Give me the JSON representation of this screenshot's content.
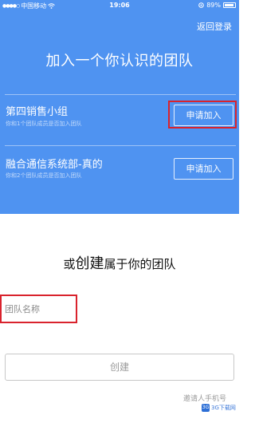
{
  "status_bar": {
    "carrier": "中国移动",
    "time": "19:06",
    "battery": "89%"
  },
  "header": {
    "back_login": "返回登录",
    "join_title": "加入一个你认识的团队"
  },
  "teams": [
    {
      "name": "第四销售小组",
      "desc": "你和1个团队成员是否加入团队",
      "button": "申请加入"
    },
    {
      "name": "融合通信系统部-真的",
      "desc": "你和2个团队成员是否加入团队",
      "button": "申请加入"
    }
  ],
  "create": {
    "title_prefix": "或",
    "title_big": "创建",
    "title_suffix": "属于你的团队",
    "input_placeholder": "团队名称",
    "button": "创建",
    "bottom_link": "邀请人手机号"
  },
  "watermark": {
    "logo_text": "3G",
    "text": "3G下载网"
  },
  "colors": {
    "panel_blue": "#4f93f1",
    "highlight_red": "#d9232d"
  }
}
